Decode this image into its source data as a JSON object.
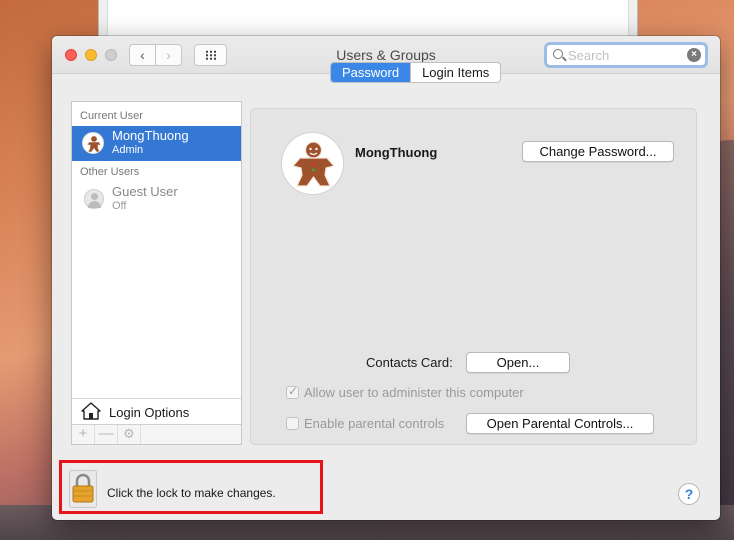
{
  "window": {
    "title": "Users & Groups"
  },
  "search": {
    "placeholder": "Search"
  },
  "sidebar": {
    "current_user_header": "Current User",
    "current_user": {
      "name": "MongThuong",
      "role": "Admin"
    },
    "other_users_header": "Other Users",
    "other_users": [
      {
        "name": "Guest User",
        "role": "Off"
      }
    ],
    "login_options_label": "Login Options",
    "toolbar": {
      "add": "+",
      "remove": "—",
      "gear": "⚙"
    }
  },
  "tabs": [
    {
      "label": "Password",
      "active": true
    },
    {
      "label": "Login Items",
      "active": false
    }
  ],
  "main": {
    "user_name": "MongThuong",
    "change_password_label": "Change Password...",
    "contacts_card_label": "Contacts Card:",
    "open_label": "Open...",
    "allow_admin_label": "Allow user to administer this computer",
    "allow_admin_checked": true,
    "parental_controls_label": "Enable parental controls",
    "parental_controls_checked": false,
    "open_parental_label": "Open Parental Controls..."
  },
  "footer": {
    "lock_text": "Click the lock to make changes.",
    "help": "?"
  },
  "colors": {
    "selection": "#3478d4",
    "tab_active": "#3b87e8",
    "highlight_box": "#e8141c",
    "close": "#fc5f57",
    "minimize": "#fdbc2e"
  },
  "icons": [
    "back-chevron-icon",
    "forward-chevron-icon",
    "grid-icon",
    "search-icon",
    "clear-icon",
    "gingerbread-avatar-icon",
    "guest-avatar-icon",
    "house-icon",
    "gear-icon",
    "lock-icon",
    "help-icon"
  ]
}
